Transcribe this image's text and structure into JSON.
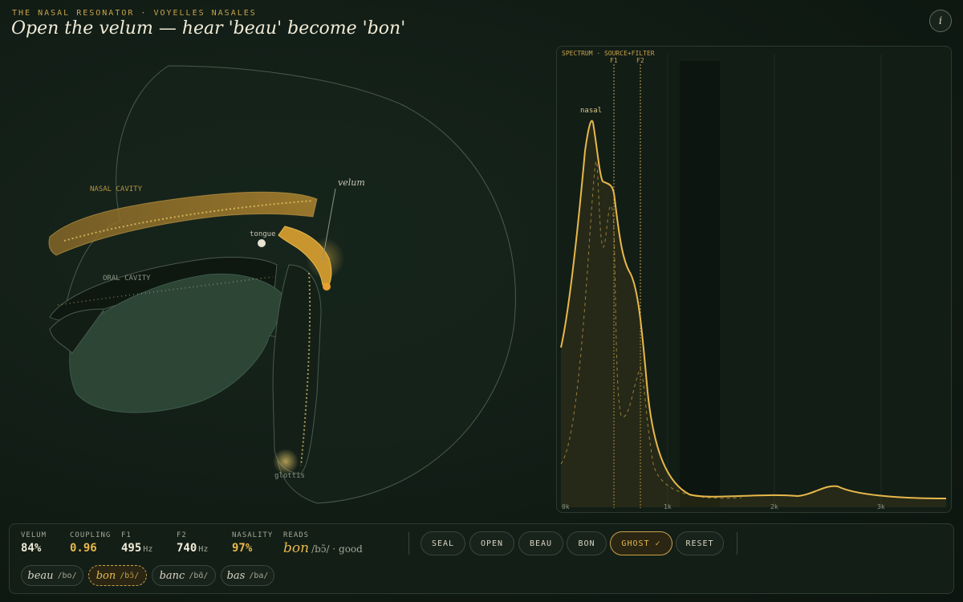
{
  "header": {
    "kicker": "THE NASAL RESONATOR · VOYELLES NASALES",
    "title": "Open the velum — hear 'beau' become 'bon'",
    "info_icon": "info-icon",
    "info_glyph": "i"
  },
  "anatomy": {
    "labels": {
      "nasal_cavity": "NASAL CAVITY",
      "oral_cavity": "ORAL CAVITY",
      "tongue": "tongue",
      "velum": "velum",
      "glottis": "glottis"
    },
    "colors": {
      "accent": "#e8b84a",
      "tongue_fill": "#2c4535"
    }
  },
  "spectrum": {
    "title": "SPECTRUM · SOURCE+FILTER",
    "markers": [
      "F1",
      "F2"
    ],
    "peak_label": "nasal",
    "x_ticks": [
      "0k",
      "1k",
      "2k",
      "3k"
    ]
  },
  "stats": {
    "velum": {
      "label": "VELUM",
      "value": "84%"
    },
    "coupling": {
      "label": "COUPLING",
      "value": "0.96"
    },
    "f1": {
      "label": "F1",
      "value": "495",
      "unit": "Hz"
    },
    "f2": {
      "label": "F2",
      "value": "740",
      "unit": "Hz"
    },
    "nasality": {
      "label": "NASALITY",
      "value": "97%"
    },
    "reads": {
      "label": "READS",
      "word": "bon",
      "detail": "/bɔ̃/ · good"
    }
  },
  "buttons": {
    "seal": "SEAL",
    "open": "OPEN",
    "beau": "BEAU",
    "bon": "BON",
    "ghost": "GHOST ✓",
    "reset": "RESET"
  },
  "chips": [
    {
      "word": "beau",
      "ipa": "/bo/"
    },
    {
      "word": "bon",
      "ipa": "/bɔ̃/"
    },
    {
      "word": "banc",
      "ipa": "/bɑ̃/"
    },
    {
      "word": "bas",
      "ipa": "/ba/"
    }
  ]
}
